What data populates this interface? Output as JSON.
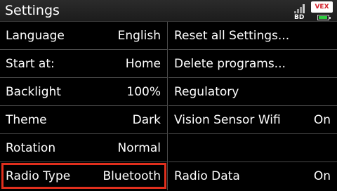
{
  "header": {
    "title": "Settings",
    "bd_label": "BD",
    "brand_logo_text": "VEX",
    "brand_color": "#d4202a",
    "battery_level": 0.8,
    "battery_color": "#2ecc40",
    "icons": [
      "signal-bars-icon",
      "brand-logo",
      "battery-icon"
    ]
  },
  "settings": {
    "left": [
      {
        "label": "Language",
        "value": "English"
      },
      {
        "label": "Start at:",
        "value": "Home"
      },
      {
        "label": "Backlight",
        "value": "100%"
      },
      {
        "label": "Theme",
        "value": "Dark"
      },
      {
        "label": "Rotation",
        "value": "Normal"
      },
      {
        "label": "Radio Type",
        "value": "Bluetooth",
        "selected": true
      }
    ],
    "right": [
      {
        "label": "Reset all Settings...",
        "value": ""
      },
      {
        "label": "Delete programs...",
        "value": ""
      },
      {
        "label": "Regulatory",
        "value": ""
      },
      {
        "label": "Vision Sensor Wifi",
        "value": "On"
      },
      {
        "label": "",
        "value": ""
      },
      {
        "label": "Radio Data",
        "value": "On"
      }
    ]
  },
  "colors": {
    "selection_border": "#e02f1d",
    "background": "#000000",
    "divider": "#4a4a4a"
  }
}
